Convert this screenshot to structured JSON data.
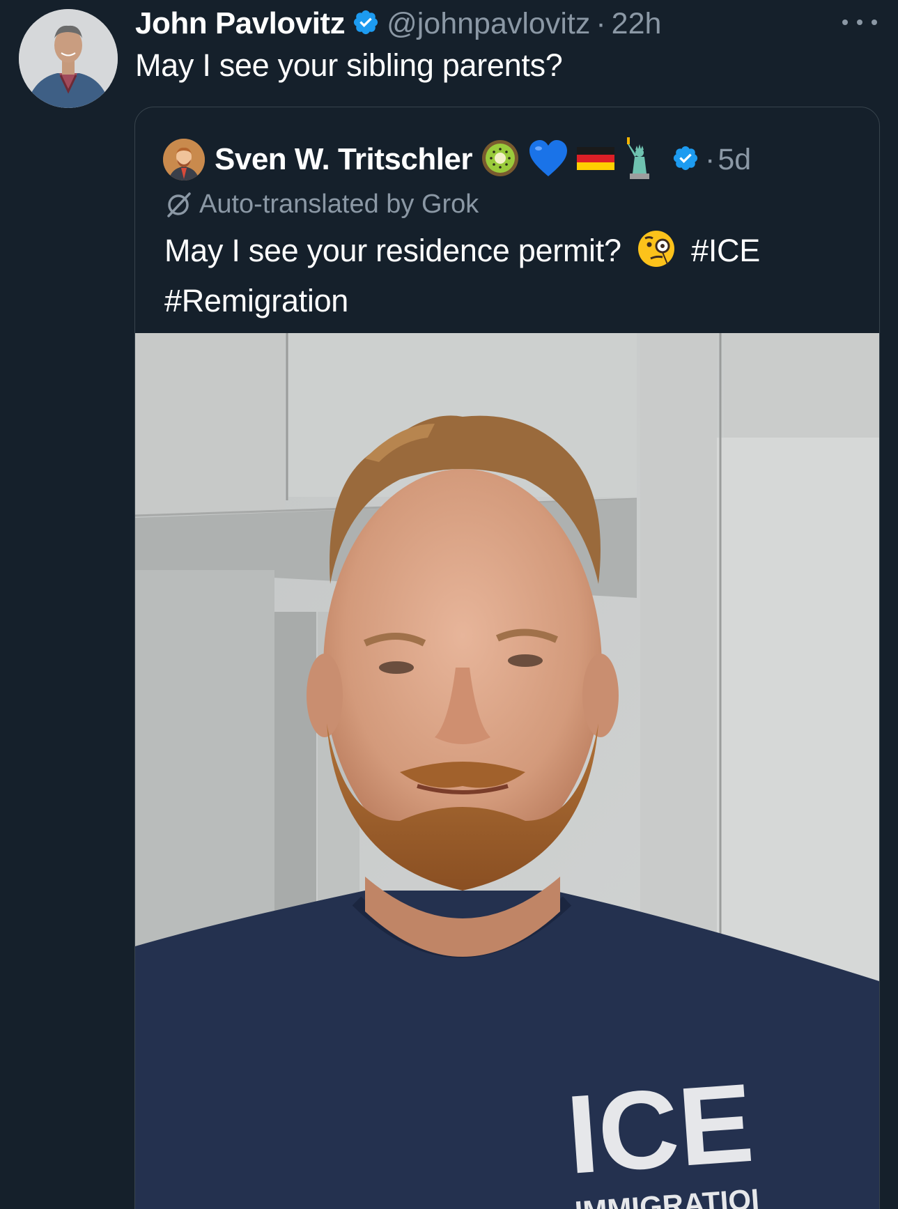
{
  "tweet": {
    "author": {
      "display_name": "John Pavlovitz",
      "handle": "@johnpavlovitz",
      "verified": true
    },
    "separator": "·",
    "time": "22h",
    "text": "May I see your sibling parents?",
    "more_icon": "more-horizontal-icon"
  },
  "quoted_tweet": {
    "author": {
      "display_name": "Sven W. Tritschler",
      "name_emojis": [
        "kiwi-fruit",
        "blue-heart",
        "germany-flag",
        "statue-of-liberty"
      ],
      "verified": true
    },
    "separator": "·",
    "time": "5d",
    "translation_note": "Auto-translated by Grok",
    "text_part1": "May I see your residence permit?",
    "text_emoji": "face-with-monocle",
    "hashtag1": "#ICE",
    "hashtag2": "#Remigration",
    "photo": {
      "shirt_text_main": "ICE",
      "shirt_text_sub": "IMMIGRATIOI"
    }
  },
  "colors": {
    "background": "#15202b",
    "text_primary": "#ffffff",
    "text_secondary": "#8b98a5",
    "verified_blue": "#1d9bf0",
    "border": "#38444d"
  }
}
